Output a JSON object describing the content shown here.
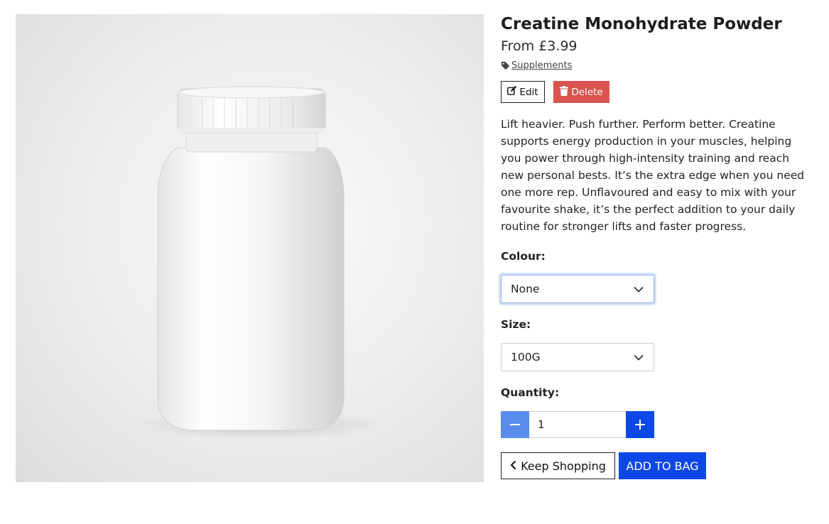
{
  "product": {
    "title": "Creatine Monohydrate Powder",
    "price": "From £3.99",
    "category": "Supplements",
    "description": "Lift heavier. Push further. Perform better. Creatine supports energy production in your muscles, helping you power through high-intensity training and reach new personal bests. It’s the extra edge when you need one more rep. Unflavoured and easy to mix with your favourite shake, it’s the perfect addition to your daily routine for stronger lifts and faster progress."
  },
  "admin": {
    "edit_label": "Edit",
    "delete_label": "Delete"
  },
  "options": {
    "colour_label": "Colour:",
    "colour_value": "None",
    "size_label": "Size:",
    "size_value": "100G",
    "quantity_label": "Quantity:",
    "quantity_value": "1"
  },
  "actions": {
    "keep_shopping_label": "Keep Shopping",
    "add_to_bag_label": "ADD TO BAG"
  },
  "icons": {
    "tag": "tag-icon",
    "edit": "edit-icon",
    "delete": "trash-icon",
    "dropdown": "chevron-down-icon",
    "minus": "minus-icon",
    "plus": "plus-icon",
    "back": "chevron-left-icon"
  },
  "colors": {
    "primary": "#0d47e8",
    "primary_light": "#5b8def",
    "danger": "#d9534f",
    "focus_ring": "#d3e2f8"
  }
}
